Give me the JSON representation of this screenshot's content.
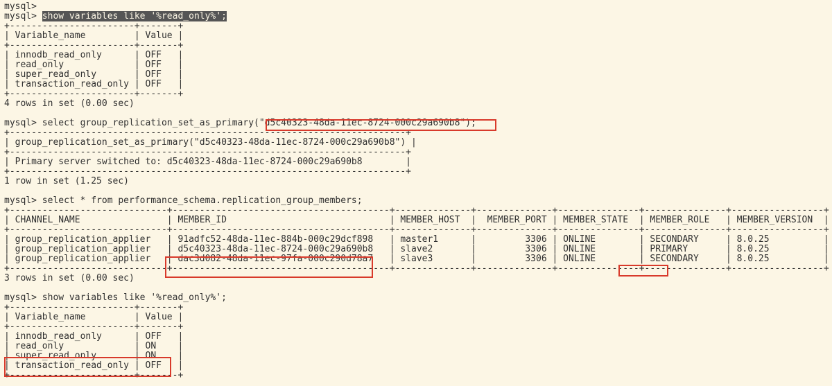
{
  "prompt": "mysql> ",
  "prompt_empty": "mysql>",
  "cmd1": "show variables like '%read_only%';",
  "table1": {
    "headers": [
      "Variable_name",
      "Value"
    ],
    "rows": [
      [
        "innodb_read_only",
        "OFF"
      ],
      [
        "read_only",
        "OFF"
      ],
      [
        "super_read_only",
        "OFF"
      ],
      [
        "transaction_read_only",
        "OFF"
      ]
    ],
    "footer": "4 rows in set (0.00 sec)"
  },
  "cmd2_pre": "select group_replication_set_as_primary(",
  "cmd2_arg": "\"d5c40323-48da-11ec-8724-000c29a690b8\");",
  "table2": {
    "header": "group_replication_set_as_primary(\"d5c40323-48da-11ec-8724-000c29a690b8\")",
    "body": "Primary server switched to: d5c40323-48da-11ec-8724-000c29a690b8",
    "footer": "1 row in set (1.25 sec)"
  },
  "cmd3": "select * from performance_schema.replication_group_members;",
  "table3": {
    "headers": [
      "CHANNEL_NAME",
      "MEMBER_ID",
      "MEMBER_HOST",
      "MEMBER_PORT",
      "MEMBER_STATE",
      "MEMBER_ROLE",
      "MEMBER_VERSION"
    ],
    "rows": [
      [
        "group_replication_applier",
        "91adfc52-48da-11ec-884b-000c29dcf898",
        "master1",
        "3306",
        "ONLINE",
        "SECONDARY",
        "8.0.25"
      ],
      [
        "group_replication_applier",
        "d5c40323-48da-11ec-8724-000c29a690b8",
        "slave2",
        "3306",
        "ONLINE",
        "PRIMARY",
        "8.0.25"
      ],
      [
        "group_replication_applier",
        "dac3d082-48da-11ec-97fa-000c290d78a7",
        "slave3",
        "3306",
        "ONLINE",
        "SECONDARY",
        "8.0.25"
      ]
    ],
    "footer": "3 rows in set (0.00 sec)"
  },
  "cmd4": "show variables like '%read_only%';",
  "table4": {
    "headers": [
      "Variable_name",
      "Value"
    ],
    "rows": [
      [
        "innodb_read_only",
        "OFF"
      ],
      [
        "read_only",
        "ON"
      ],
      [
        "super_read_only",
        "ON"
      ],
      [
        "transaction_read_only",
        "OFF"
      ]
    ]
  }
}
